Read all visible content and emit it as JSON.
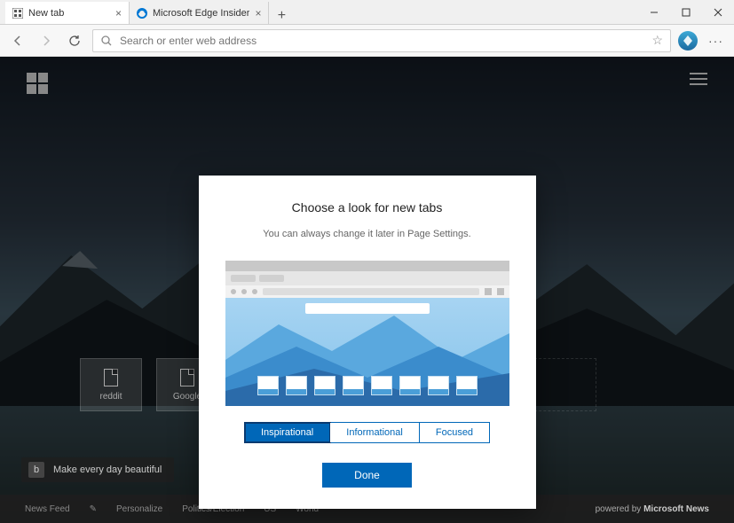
{
  "window": {
    "tabs": [
      {
        "title": "New tab",
        "active": true
      },
      {
        "title": "Microsoft Edge Insider",
        "active": false
      }
    ]
  },
  "navbar": {
    "address_placeholder": "Search or enter web address"
  },
  "newtab_bg": {
    "tiles": [
      {
        "label": "reddit"
      },
      {
        "label": "Google"
      }
    ],
    "bing_button": "Make every day beautiful",
    "footer": {
      "items": [
        "News Feed",
        "Personalize",
        "Politics/Election",
        "US",
        "World"
      ],
      "powered_by_prefix": "powered by",
      "powered_by_brand": "Microsoft News"
    }
  },
  "modal": {
    "title": "Choose a look for new tabs",
    "subtitle": "You can always change it later in Page Settings.",
    "options": {
      "inspirational": "Inspirational",
      "informational": "Informational",
      "focused": "Focused"
    },
    "done_label": "Done"
  }
}
